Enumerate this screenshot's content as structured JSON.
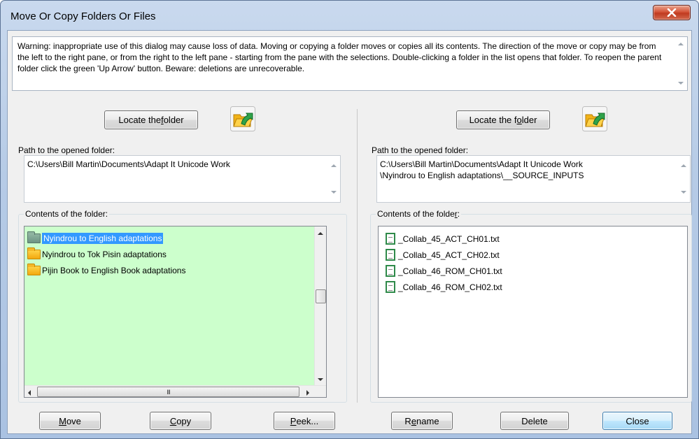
{
  "window": {
    "title": "Move Or Copy Folders Or Files",
    "close_glyph": "X"
  },
  "warning": {
    "text": "Warning: inappropriate use of this dialog may cause loss of data. Moving or copying a folder moves or copies all its contents. The direction of the move or copy may be from the left to the right pane, or from the right to the left pane - starting from the pane with the selections. Double-clicking a folder in the list opens that folder. To reopen the parent folder click the green 'Up Arrow' button. Beware: deletions are unrecoverable."
  },
  "left_pane": {
    "locate_button": {
      "pre": "Locate the ",
      "mnemonic": "f",
      "post": "older"
    },
    "up_icon": "green-up-arrow-folder-icon",
    "path_label": "Path to the opened folder:",
    "path_value": "C:\\Users\\Bill Martin\\Documents\\Adapt It Unicode Work",
    "contents_label": "Contents of the folder:",
    "items": [
      {
        "label": "Nyindrou to English adaptations",
        "icon": "folder-icon",
        "selected": true
      },
      {
        "label": "Nyindrou to Tok Pisin adaptations",
        "icon": "folder-icon",
        "selected": false
      },
      {
        "label": "Pijin Book to English Book adaptations",
        "icon": "folder-icon",
        "selected": false
      }
    ],
    "hscroll_grip": "III"
  },
  "right_pane": {
    "locate_button": {
      "pre": "Locate the f",
      "mnemonic": "o",
      "post": "lder"
    },
    "up_icon": "green-up-arrow-folder-icon",
    "path_label": "Path to the opened folder:",
    "path_value": "C:\\Users\\Bill Martin\\Documents\\Adapt It Unicode Work\n\\Nyindrou to English adaptations\\__SOURCE_INPUTS",
    "contents_label_pre": "Contents of the folde",
    "contents_label_mnemonic": "r",
    "contents_label_post": ":",
    "items": [
      {
        "label": "_Collab_45_ACT_CH01.txt",
        "icon": "text-file-icon"
      },
      {
        "label": "_Collab_45_ACT_CH02.txt",
        "icon": "text-file-icon"
      },
      {
        "label": "_Collab_46_ROM_CH01.txt",
        "icon": "text-file-icon"
      },
      {
        "label": "_Collab_46_ROM_CH02.txt",
        "icon": "text-file-icon"
      }
    ]
  },
  "buttons": {
    "move": {
      "mnemonic": "M",
      "rest": "ove"
    },
    "copy": {
      "mnemonic": "C",
      "rest": "opy"
    },
    "peek": {
      "mnemonic": "P",
      "rest": "eek..."
    },
    "rename": {
      "pre": "R",
      "mnemonic": "e",
      "rest": "name"
    },
    "delete": {
      "label": "Delete"
    },
    "close": {
      "label": "Close"
    }
  },
  "colors": {
    "left_list_bg": "#ccffcc",
    "selection": "#3399ff",
    "close_button": "#c8452a"
  }
}
